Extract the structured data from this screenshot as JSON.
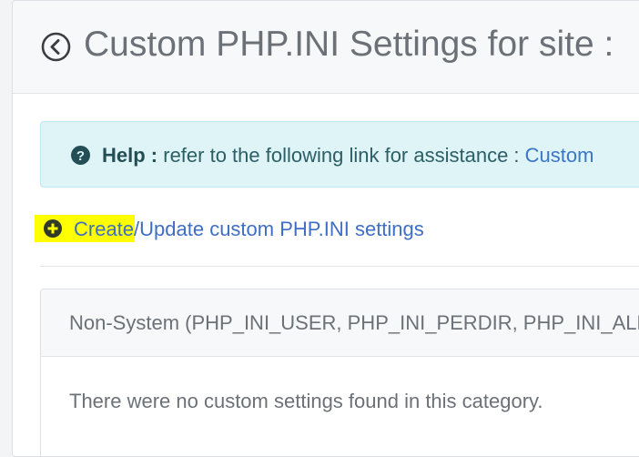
{
  "header": {
    "title": "Custom PHP.INI Settings for site :"
  },
  "help": {
    "label": "Help :",
    "text": " refer to the following link for assistance : ",
    "link_text": "Custom"
  },
  "actions": {
    "create_update_label": "Create/Update custom PHP.INI settings"
  },
  "categories": [
    {
      "title": "Non-System (PHP_INI_USER, PHP_INI_PERDIR, PHP_INI_ALL)",
      "empty_message": "There were no custom settings found in this category."
    }
  ],
  "colors": {
    "highlight": "#ffff00",
    "link": "#3f6fc4",
    "alert_background": "#dff4f7"
  },
  "icons": {
    "back": "chevron-left-circle-icon",
    "help": "question-circle-icon",
    "create": "plus-circle-icon"
  }
}
